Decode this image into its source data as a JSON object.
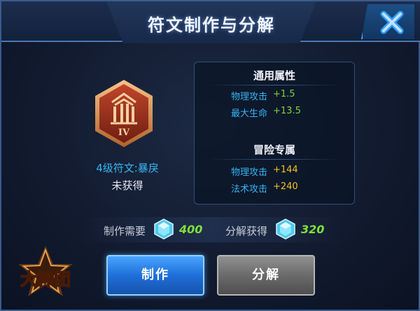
{
  "header": {
    "title": "符文制作与分解"
  },
  "rune": {
    "name": "4级符文:暴戾",
    "status": "未获得",
    "tier_numeral": "IV"
  },
  "attributes": {
    "common": {
      "title": "通用属性",
      "rows": [
        {
          "label": "物理攻击",
          "value": "+1.5"
        },
        {
          "label": "最大生命",
          "value": "+13.5"
        }
      ]
    },
    "adventure": {
      "title": "冒险专属",
      "rows": [
        {
          "label": "物理攻击",
          "value": "+144"
        },
        {
          "label": "法术攻击",
          "value": "+240"
        }
      ]
    }
  },
  "costs": {
    "make_label": "制作需要",
    "make_amount": "400",
    "decompose_label": "分解获得",
    "decompose_amount": "320"
  },
  "buttons": {
    "make": "制作",
    "decompose": "分解"
  },
  "logo": {
    "text": "大神团"
  },
  "colors": {
    "accent_blue": "#37b6f2",
    "value_green": "#7dd43a",
    "value_yellow": "#f3c11f",
    "crystal_number_green": "#7fe03a"
  }
}
